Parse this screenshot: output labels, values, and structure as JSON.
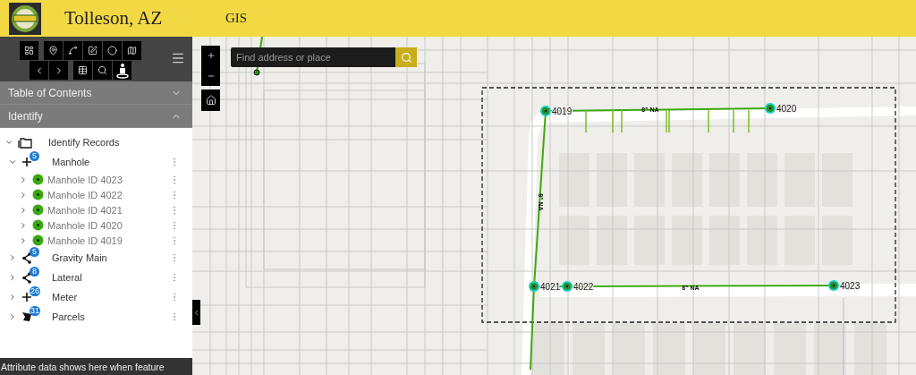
{
  "header": {
    "city": "Tolleson, AZ",
    "app": "GIS"
  },
  "panels": [
    {
      "title": "Table of Contents",
      "expanded": false
    },
    {
      "title": "Identify",
      "expanded": true
    }
  ],
  "identify": {
    "label": "Identify Records",
    "expanded": true,
    "layers": [
      {
        "name": "Manhole",
        "count": "5",
        "kind": "point",
        "expanded": true,
        "children": [
          {
            "label": "Manhole ID 4023",
            "expanded": false
          },
          {
            "label": "Manhole ID 4022",
            "expanded": false
          },
          {
            "label": "Manhole ID 4021",
            "expanded": false
          },
          {
            "label": "Manhole ID 4020",
            "expanded": false
          },
          {
            "label": "Manhole ID 4019",
            "expanded": false
          }
        ]
      },
      {
        "name": "Gravity Main",
        "count": "5",
        "kind": "line",
        "expanded": false
      },
      {
        "name": "Lateral",
        "count": "8",
        "kind": "line",
        "expanded": false
      },
      {
        "name": "Meter",
        "count": "26",
        "kind": "point",
        "expanded": false
      },
      {
        "name": "Parcels",
        "count": "31",
        "kind": "polygon",
        "expanded": false
      }
    ]
  },
  "status_bar": "Attribute data shows here when feature",
  "search": {
    "placeholder": "Find address or place"
  },
  "map": {
    "manholes": [
      {
        "label": "4019"
      },
      {
        "label": "4020"
      },
      {
        "label": "4021"
      },
      {
        "label": "4022"
      },
      {
        "label": "4023"
      }
    ],
    "pipe_labels": [
      "8\" NA",
      "8\" NA",
      "8\" NA"
    ]
  }
}
